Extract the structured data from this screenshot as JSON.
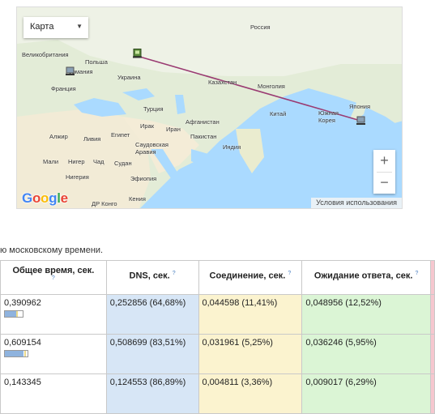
{
  "map": {
    "type_control": {
      "selected": "Карта"
    },
    "zoom": {
      "in": "+",
      "out": "−"
    },
    "logo": [
      "G",
      "o",
      "o",
      "g",
      "l",
      "e"
    ],
    "terms": "Условия использования",
    "labels": {
      "russia": "Россия",
      "uk": "Великобритания",
      "poland": "Польша",
      "germany": "Германия",
      "france": "Франция",
      "ukraine": "Украина",
      "kazakhstan": "Казахстан",
      "mongolia": "Монголия",
      "china": "Китай",
      "japan": "Япония",
      "south_korea": "Южная Корея",
      "turkey": "Турция",
      "iraq": "Ирак",
      "iran": "Иран",
      "afghanistan": "Афганистан",
      "pakistan": "Пакистан",
      "india": "Индия",
      "algeria": "Алжир",
      "libya": "Ливия",
      "egypt": "Египет",
      "saudi": "Саудовская Аравия",
      "mali": "Мали",
      "niger": "Нигер",
      "chad": "Чад",
      "sudan": "Судан",
      "nigeria": "Нигерия",
      "ethiopia": "Эфиопия",
      "kenya": "Кения",
      "drc": "ДР Конго"
    }
  },
  "caption": "ю московскому времени.",
  "table": {
    "headers": [
      "Общее время, сек.",
      "DNS, сек.",
      "Соединение, сек.",
      "Ожидание ответа, сек."
    ],
    "help_glyph": "?",
    "rows": [
      {
        "total": "0,390962",
        "dns": "0,252856 (64,68%)",
        "connect": "0,044598 (11,41%)",
        "wait": "0,048956 (12,52%)",
        "dns_share": 64.68
      },
      {
        "total": "0,609154",
        "dns": "0,508699 (83,51%)",
        "connect": "0,031961 (5,25%)",
        "wait": "0,036246 (5,95%)",
        "dns_share": 83.51
      },
      {
        "total": "0,143345",
        "dns": "0,124553 (86,89%)",
        "connect": "0,004811 (3,36%)",
        "wait": "0,009017 (6,29%)",
        "dns_share": 86.89
      }
    ]
  },
  "colors": {
    "dns": "#d7e6f6",
    "connect": "#fbf3cf",
    "wait": "#dbf5d5",
    "extra": "#f6c7cf",
    "route": "#9a3b72"
  }
}
